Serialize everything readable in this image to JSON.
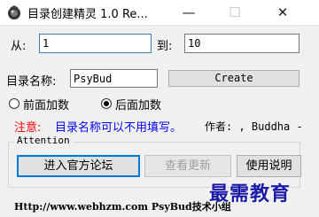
{
  "window": {
    "title": "目录创建精灵 1.0 Re...",
    "minimize_glyph": "—",
    "maximize_glyph": "☐",
    "close_glyph": "✕"
  },
  "range": {
    "from_label": "从:",
    "from_value": "1",
    "to_label": "到:",
    "to_value": "10"
  },
  "name": {
    "label": "目录名称:",
    "value": "PsyBud",
    "create_button": "Create"
  },
  "options": {
    "prefix_label": "前面加数",
    "suffix_label": "后面加数",
    "selected": "suffix"
  },
  "note": {
    "prefix": "注意:",
    "text": "目录名称可以不用填写。",
    "author": "作者: , Buddha -"
  },
  "group": {
    "legend": "Attention",
    "forum_button": "进入官方论坛",
    "update_button": "查看更新",
    "help_button": "使用说明"
  },
  "footer": {
    "text": "Http://www.webhzm.com   PsyBud技术小组"
  },
  "watermark": {
    "text": "最需教育"
  }
}
